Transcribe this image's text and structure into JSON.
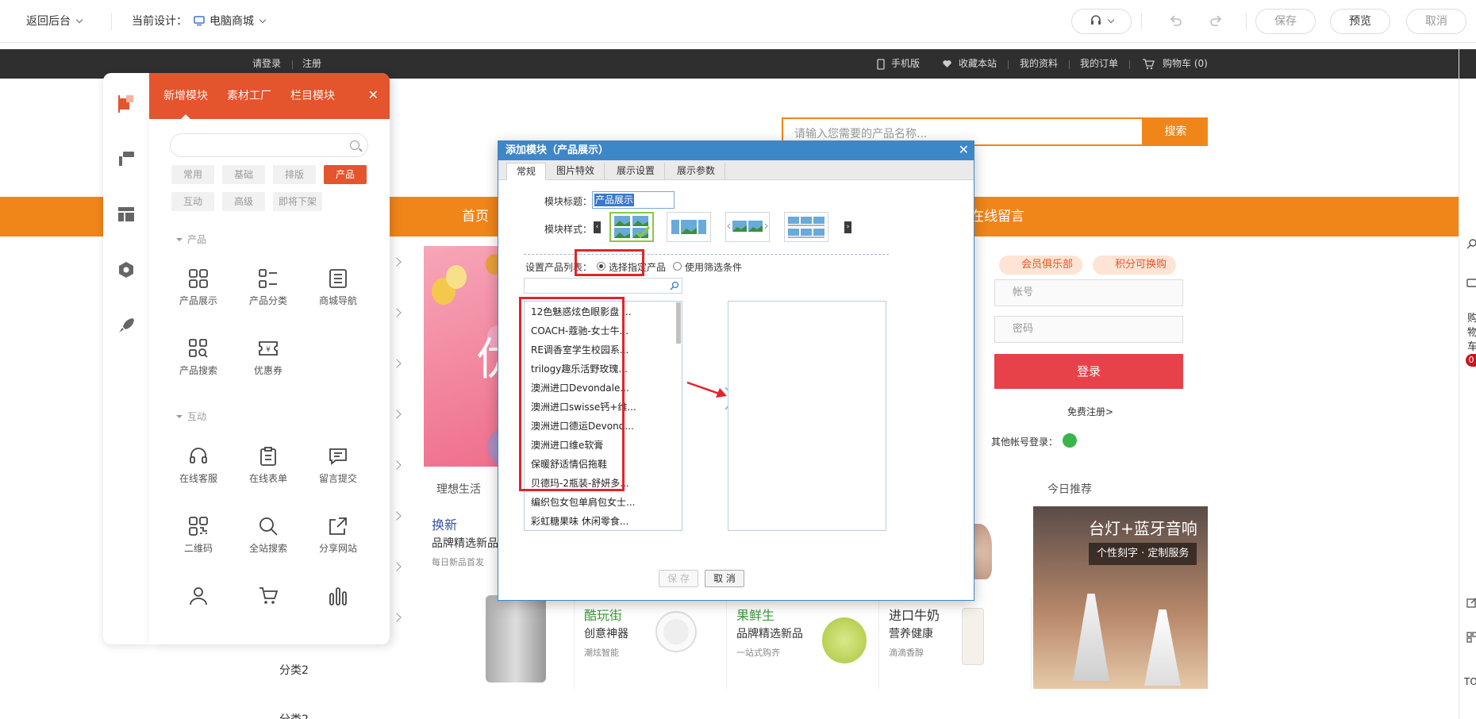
{
  "topbar": {
    "back": "返回后台",
    "current_label": "当前设计：",
    "design": "电脑商城",
    "save": "保存",
    "preview": "预览",
    "cancel": "取消"
  },
  "site": {
    "login": "请登录",
    "register": "注册",
    "mobile": "手机版",
    "favorite": "收藏本站",
    "profile": "我的资料",
    "orders": "我的订单",
    "cart": "购物车 (0)",
    "search_placeholder": "请输入您需要的产品名称...",
    "search_button": "搜索",
    "nav": [
      "首页",
      "在线留言"
    ],
    "section_left": "理想生活",
    "section_right": "今日推荐",
    "category": "分类2",
    "category_cut": "分类2",
    "cards": [
      {
        "tag": "换新",
        "title": "品牌精选新品",
        "sub": "每日新品首发"
      },
      {
        "tag": "酷玩街",
        "title": "创意神器",
        "sub": "潮炫智能"
      },
      {
        "tag": "果鲜生",
        "title": "品牌精选新品",
        "sub": "一站式购齐"
      },
      {
        "tag": "进口牛奶",
        "title": "营养健康",
        "sub": "滴滴香醇"
      }
    ],
    "promo_title": "台灯+蓝牙音响",
    "promo_sub": "个性刻字 · 定制服务",
    "member_club": "会员俱乐部",
    "points": "积分可换购",
    "account": "帐号",
    "password": "密码",
    "login_button": "登录",
    "free_register": "免费注册>",
    "other_login": "其他帐号登录：",
    "side_text": [
      "购",
      "物",
      "车"
    ],
    "side_count": "0",
    "side_bottom": "TO"
  },
  "panel": {
    "tabs": [
      "新增模块",
      "素材工厂",
      "栏目模块"
    ],
    "chips": [
      "常用",
      "基础",
      "排版",
      "产品",
      "互动",
      "高级",
      "即将下架"
    ],
    "group_product": "产品",
    "group_interact": "互动",
    "tools_product": [
      "产品展示",
      "产品分类",
      "商城导航",
      "产品搜索",
      "优惠券"
    ],
    "tools_interact": [
      "在线客服",
      "在线表单",
      "留言提交",
      "二维码",
      "全站搜索",
      "分享网站"
    ]
  },
  "dialog": {
    "title": "添加模块（产品展示）",
    "tabs": [
      "常规",
      "图片特效",
      "展示设置",
      "展示参数"
    ],
    "module_title_label": "模块标题：",
    "module_title_value": "产品展示",
    "module_style_label": "模块样式：",
    "list_label": "设置产品列表：",
    "radio_select": "选择指定产品",
    "radio_filter": "使用筛选条件",
    "products": [
      "12色魅惑炫色眼影盘 ...",
      "COACH-蔻驰-女士牛...",
      "RE调香室学生校园系...",
      "trilogy趣乐活野玫瑰...",
      "澳洲进口Devondale...",
      "澳洲进口swisse钙+维...",
      "澳洲进口德运Devond...",
      "澳洲进口维e软膏",
      "保暖舒适情侣拖鞋",
      "贝德玛-2瓶装-舒妍多...",
      "编织包女包单肩包女士...",
      "彩虹糖果味 休闲零食..."
    ],
    "save": "保 存",
    "cancel": "取 消"
  },
  "colors": {
    "accent_orange": "#f08519",
    "panel_red": "#e4542d",
    "dialog_blue": "#3d87c9",
    "highlight_red": "#e3232b",
    "login_red": "#e7424a"
  }
}
